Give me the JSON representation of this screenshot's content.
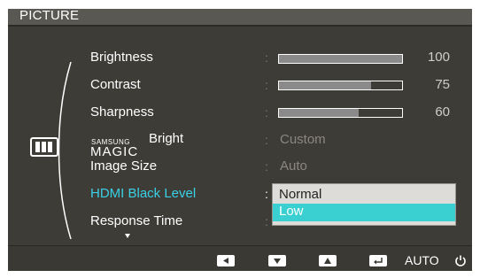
{
  "menu": {
    "title": "PICTURE",
    "items": [
      {
        "label": "Brightness",
        "value": 100
      },
      {
        "label": "Contrast",
        "value": 75
      },
      {
        "label": "Sharpness",
        "value": 60
      },
      {
        "label_prefix": "SAMSUNG",
        "label_main": "MAGIC",
        "label_suffix": "Bright",
        "value": "Custom"
      },
      {
        "label": "Image Size",
        "value": "Auto"
      },
      {
        "label": "HDMI Black Level",
        "value": "Normal",
        "active": true
      },
      {
        "label": "Response Time",
        "value": ""
      }
    ],
    "separator": ":",
    "dropdown": {
      "options": [
        "Normal",
        "Low"
      ],
      "selected": "Low"
    },
    "more_indicator": "chevron-down-icon"
  },
  "buttons": [
    {
      "icon": "left-arrow-icon"
    },
    {
      "icon": "down-arrow-icon"
    },
    {
      "icon": "up-arrow-icon"
    },
    {
      "icon": "enter-icon"
    },
    {
      "label": "AUTO"
    },
    {
      "icon": "power-icon"
    }
  ],
  "colors": {
    "panel": "#3e3c37",
    "title_bar": "#5a5852",
    "active_label": "#3ad0e6",
    "selected_option": "#3acfd0"
  }
}
